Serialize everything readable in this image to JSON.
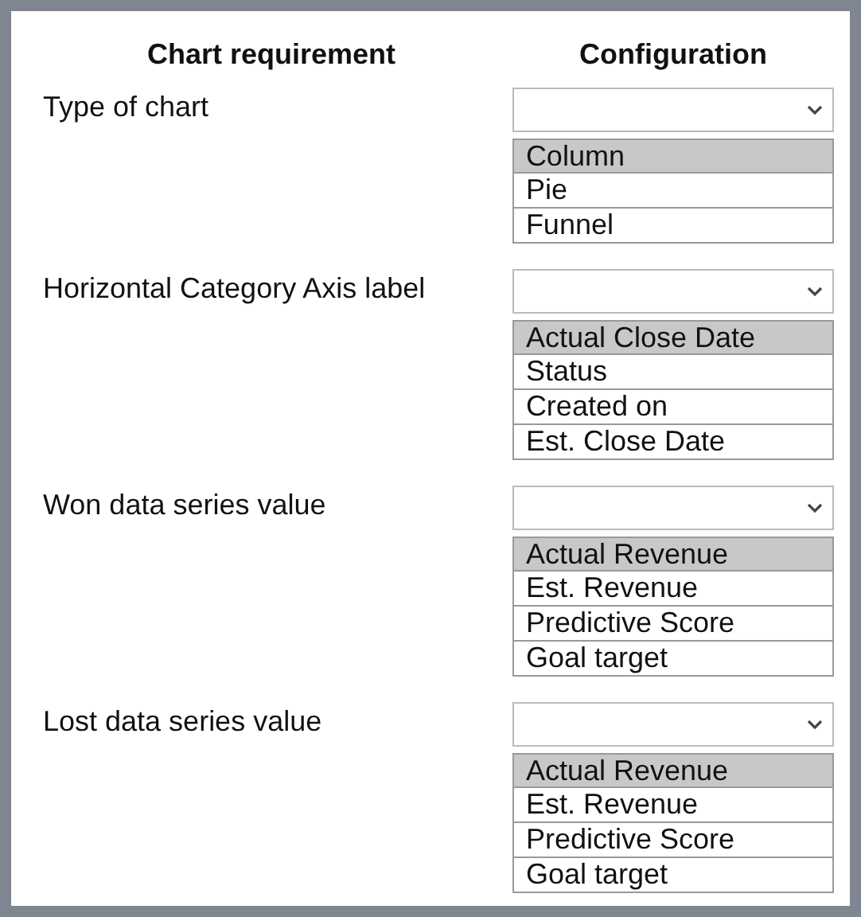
{
  "headers": [
    "Chart requirement",
    "Configuration"
  ],
  "requirements": [
    {
      "label": "Type of chart",
      "options": [
        {
          "text": "Column",
          "selected": true
        },
        {
          "text": "Pie",
          "selected": false
        },
        {
          "text": "Funnel",
          "selected": false
        }
      ]
    },
    {
      "label": "Horizontal Category Axis label",
      "options": [
        {
          "text": "Actual Close Date",
          "selected": true
        },
        {
          "text": "Status",
          "selected": false
        },
        {
          "text": "Created on",
          "selected": false
        },
        {
          "text": "Est. Close Date",
          "selected": false
        }
      ]
    },
    {
      "label": "Won data series value",
      "options": [
        {
          "text": "Actual Revenue",
          "selected": true
        },
        {
          "text": "Est. Revenue",
          "selected": false
        },
        {
          "text": "Predictive Score",
          "selected": false
        },
        {
          "text": "Goal target",
          "selected": false
        }
      ]
    },
    {
      "label": "Lost data series value",
      "options": [
        {
          "text": "Actual Revenue",
          "selected": true
        },
        {
          "text": "Est. Revenue",
          "selected": false
        },
        {
          "text": "Predictive Score",
          "selected": false
        },
        {
          "text": "Goal target",
          "selected": false
        }
      ]
    }
  ]
}
